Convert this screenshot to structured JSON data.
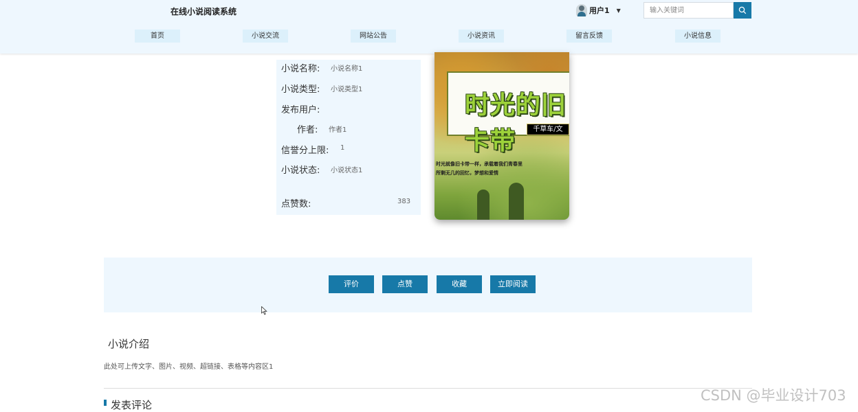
{
  "header": {
    "site_title": "在线小说阅读系统",
    "user_name": "用户1",
    "search_placeholder": "输入关键词",
    "nav": [
      "首页",
      "小说交流",
      "网站公告",
      "小说资讯",
      "留言反馈",
      "小说信息"
    ]
  },
  "novel": {
    "fields": [
      {
        "label": "小说名称:",
        "value": "小说名称1"
      },
      {
        "label": "小说类型:",
        "value": "小说类型1"
      },
      {
        "label": "发布用户:",
        "value": ""
      },
      {
        "label": "作者:",
        "value": "作者1"
      },
      {
        "label": "信誉分上限:",
        "value": "1"
      },
      {
        "label": "小说状态:",
        "value": "小说状态1"
      },
      {
        "label": "点赞数:",
        "value": "383"
      }
    ],
    "cover": {
      "title": "时光的旧卡带",
      "author": "千草车/文",
      "tagline_1": "时光就像旧卡带一样，承载着我们青春里",
      "tagline_2": "所剩无几的回忆，梦想和爱情"
    }
  },
  "actions": [
    "评价",
    "点赞",
    "收藏",
    "立即阅读"
  ],
  "intro": {
    "title": "小说介绍",
    "text": "此处可上传文字、图片、视频、超链接、表格等内容区1"
  },
  "comments": {
    "title": "发表评论"
  },
  "watermark": "CSDN @毕业设计703",
  "colors": {
    "primary": "#1779a8",
    "header_bg": "#eef7fe",
    "nav_bg": "#dcf0fb"
  },
  "icons": {
    "search": "search-icon",
    "caret": "caret-down-icon",
    "cursor": "mouse-cursor-icon"
  }
}
